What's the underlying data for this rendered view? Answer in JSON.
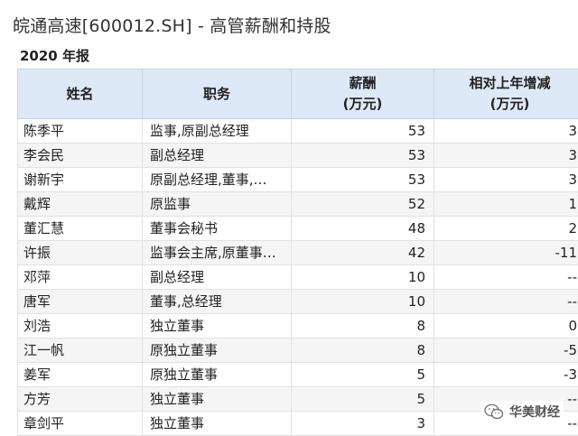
{
  "title": "皖通高速[600012.SH] - 高管薪酬和持股",
  "subtitle": "2020 年报",
  "headers": {
    "name": "姓名",
    "position": "职务",
    "salary_line1": "薪酬",
    "salary_line2": "(万元)",
    "change_line1": "相对上年增减",
    "change_line2": "(万元)"
  },
  "rows": [
    {
      "name": "陈季平",
      "position": "监事,原副总经理",
      "salary": "53",
      "change": "3"
    },
    {
      "name": "李会民",
      "position": "副总经理",
      "salary": "53",
      "change": "3"
    },
    {
      "name": "谢新宇",
      "position": "原副总经理,董事,…",
      "salary": "53",
      "change": "3"
    },
    {
      "name": "戴辉",
      "position": "原监事",
      "salary": "52",
      "change": "1"
    },
    {
      "name": "董汇慧",
      "position": "董事会秘书",
      "salary": "48",
      "change": "2"
    },
    {
      "name": "许振",
      "position": "监事会主席,原董事…",
      "salary": "42",
      "change": "-11"
    },
    {
      "name": "邓萍",
      "position": "副总经理",
      "salary": "10",
      "change": "--"
    },
    {
      "name": "唐军",
      "position": "董事,总经理",
      "salary": "10",
      "change": "--"
    },
    {
      "name": "刘浩",
      "position": "独立董事",
      "salary": "8",
      "change": "0"
    },
    {
      "name": "江一帆",
      "position": "原独立董事",
      "salary": "8",
      "change": "-5"
    },
    {
      "name": "姜军",
      "position": "原独立董事",
      "salary": "5",
      "change": "-3"
    },
    {
      "name": "方芳",
      "position": "独立董事",
      "salary": "5",
      "change": "--"
    },
    {
      "name": "章剑平",
      "position": "独立董事",
      "salary": "3",
      "change": "--"
    }
  ],
  "watermark": {
    "text": "华美财经",
    "icon": "wechat-icon"
  }
}
